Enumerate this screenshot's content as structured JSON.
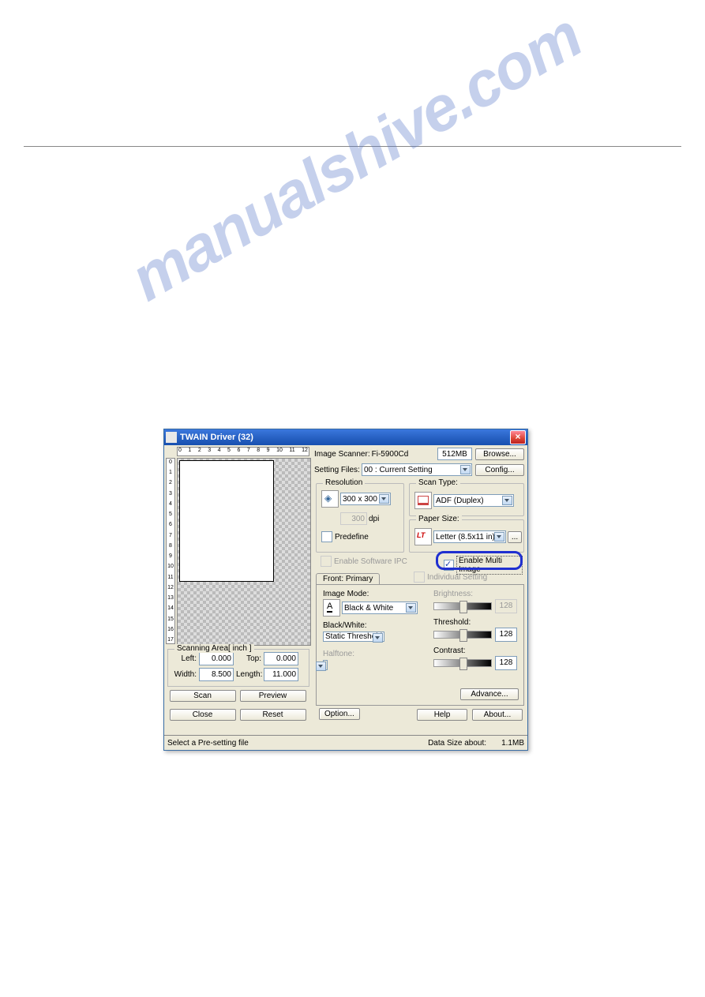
{
  "watermark_text": "manualshive.com",
  "window": {
    "title": "TWAIN Driver (32)",
    "image_scanner_label": "Image Scanner:",
    "image_scanner_value": "Fi-5900Cd",
    "memory": "512MB",
    "browse_btn": "Browse...",
    "setting_files_label": "Setting Files:",
    "setting_files_value": "00 : Current Setting",
    "config_btn": "Config...",
    "resolution": {
      "label": "Resolution",
      "value": "300 x 300",
      "custom_value": "300",
      "dpi_label": "dpi",
      "predefine_label": "Predefine"
    },
    "scan_type": {
      "label": "Scan Type:",
      "value": "ADF (Duplex)"
    },
    "paper_size": {
      "label": "Paper Size:",
      "value": "Letter (8.5x11 in)"
    },
    "enable_software_ipc": "Enable Software IPC",
    "enable_multi_image": "Enable Multi Image",
    "individual_setting": "Individual Setting",
    "tab_front_primary": "Front: Primary",
    "image_mode": {
      "label": "Image Mode:",
      "value": "Black & White"
    },
    "black_white": {
      "label": "Black/White:",
      "value": "Static Threshold"
    },
    "halftone_label": "Halftone:",
    "brightness_label": "Brightness:",
    "brightness_value": "128",
    "threshold_label": "Threshold:",
    "threshold_value": "128",
    "contrast_label": "Contrast:",
    "contrast_value": "128",
    "advance_btn": "Advance...",
    "scanning_area": {
      "label": "Scanning Area[ inch ]",
      "left_label": "Left:",
      "left_value": "0.000",
      "top_label": "Top:",
      "top_value": "0.000",
      "width_label": "Width:",
      "width_value": "8.500",
      "length_label": "Length:",
      "length_value": "11.000"
    },
    "scan_btn": "Scan",
    "preview_btn": "Preview",
    "close_btn": "Close",
    "reset_btn": "Reset",
    "option_btn": "Option...",
    "help_btn": "Help",
    "about_btn": "About...",
    "statusbar_left": "Select a Pre-setting file",
    "statusbar_right_label": "Data Size about:",
    "statusbar_right_value": "1.1MB"
  },
  "ruler_top": [
    "0",
    "1",
    "2",
    "3",
    "4",
    "5",
    "6",
    "7",
    "8",
    "9",
    "10",
    "11",
    "12"
  ],
  "ruler_left": [
    "0",
    "1",
    "2",
    "3",
    "4",
    "5",
    "6",
    "7",
    "8",
    "9",
    "10",
    "11",
    "12",
    "13",
    "14",
    "15",
    "16",
    "17"
  ]
}
